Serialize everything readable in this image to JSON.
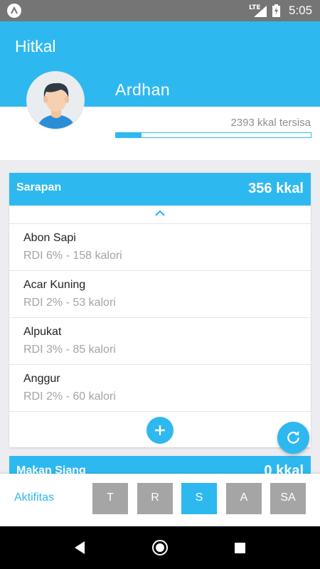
{
  "status_bar": {
    "network": "LTE",
    "time": "5:05",
    "app_icon": "app-launcher-icon"
  },
  "header": {
    "title": "Hitkal",
    "user_name": "Ardhan",
    "kcal_remaining": "2393 kkal tersisa",
    "progress_fraction": 0.13
  },
  "meals": [
    {
      "name": "Sarapan",
      "kcal": "356 kkal",
      "items": [
        {
          "name": "Abon Sapi",
          "rdi": "RDI 6% - 158 kalori"
        },
        {
          "name": "Acar Kuning",
          "rdi": "RDI 2% - 53 kalori"
        },
        {
          "name": "Alpukat",
          "rdi": "RDI 3% - 85 kalori"
        },
        {
          "name": "Anggur",
          "rdi": "RDI 2% - 60 kalori"
        }
      ]
    },
    {
      "name": "Makan Siang",
      "kcal": "0 kkal"
    }
  ],
  "bottom_bar": {
    "activity_label": "Aktifitas",
    "days": [
      "T",
      "R",
      "S",
      "A",
      "SA"
    ],
    "selected_day": "S"
  },
  "colors": {
    "primary": "#2eb8f0",
    "tab_inactive": "#a5a5a5"
  },
  "icons": {
    "collapse": "chevron-up-icon",
    "add": "plus-icon",
    "refresh": "refresh-icon"
  }
}
